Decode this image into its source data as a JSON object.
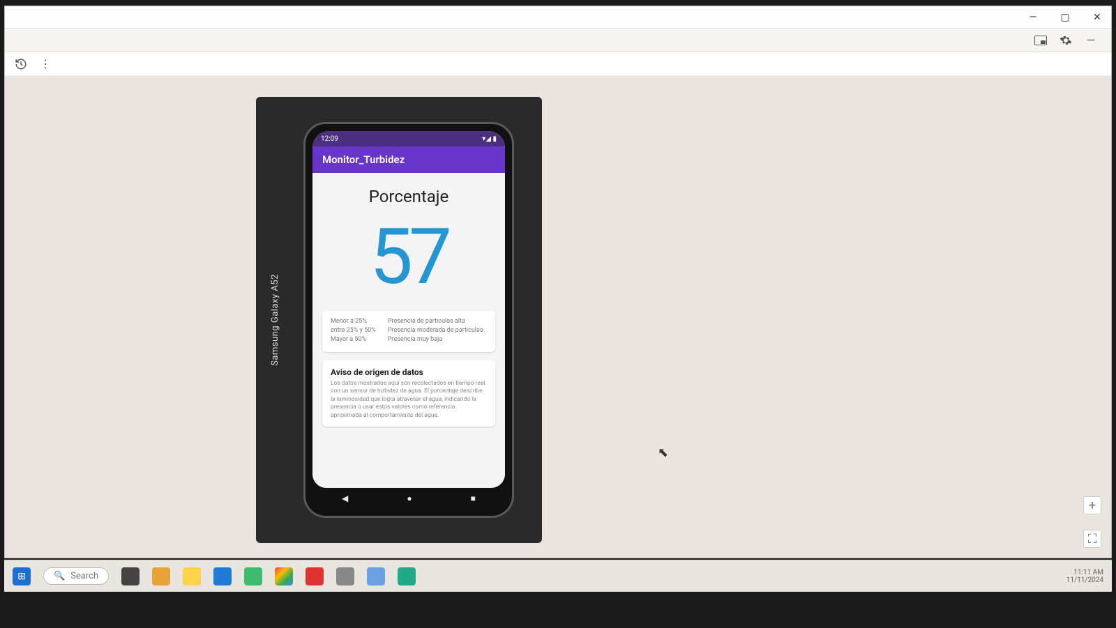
{
  "window": {
    "controls": {
      "minimize": "—",
      "maximize": "▢",
      "close": "✕"
    },
    "subbar": {
      "pip": "pip",
      "settings": "settings",
      "more": "—"
    },
    "leftbar": {
      "refresh": "refresh",
      "menu": "⋮"
    },
    "zoom": {
      "plus": "+",
      "fit": "⛶"
    }
  },
  "device": {
    "label": "Samsung Galaxy A52"
  },
  "phone": {
    "status": {
      "time": "12:09",
      "icons": "▾◢ ▮"
    },
    "app_title": "Monitor_Turbidez",
    "percentage": {
      "label": "Porcentaje",
      "value": "57"
    },
    "legend": [
      {
        "l": "Menor a 25%",
        "r": "Presencia de particulas alta"
      },
      {
        "l": "entre 25% y 50%",
        "r": "Presencia moderada de particulas"
      },
      {
        "l": "Mayor a 50%",
        "r": "Presencia muy baja"
      }
    ],
    "info": {
      "title": "Aviso de origen de datos",
      "body": "Los datos mostrados aqui son recolectados en tiempo real con un sensor de turbidez de agua. El porcentaje describe la luminosidad que logra atravesar el agua, indicando la presencia o usar estos valores como referencia aproximada al comportamiento del agua."
    },
    "nav": {
      "back": "◀",
      "home": "●",
      "recent": "■"
    }
  },
  "taskbar": {
    "start": "⊞",
    "search": "Search",
    "time": "11:11 AM",
    "date": "11/11/2024"
  }
}
